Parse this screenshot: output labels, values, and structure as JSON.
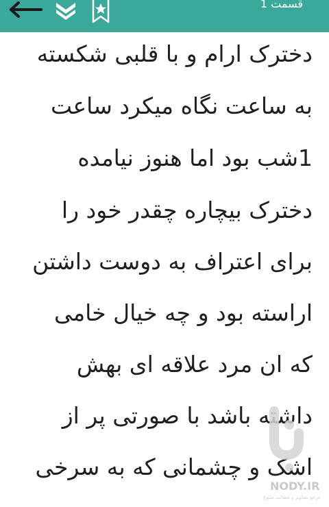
{
  "toolbar": {
    "chapter_title": "قسمت 1",
    "colors": {
      "bar": "#3aa89a",
      "icon": "#ffffff",
      "back_icon": "#1a1a1a"
    },
    "icons": {
      "back": "arrow-left-icon",
      "layers": "layers-chevron-icon",
      "bookmark": "bookmark-star-icon"
    }
  },
  "story": {
    "lines": [
      "دخترک ارام و با قلبی شکسته",
      "به ساعت نگاه میکرد ساعت",
      "1شب بود اما هنوز نیامده",
      "دخترک بیچاره چقدر خود را",
      "برای اعتراف به دوست داشتن",
      "اراسته بود و چه خیال خامی",
      "که ان مرد علاقه ای بهش",
      "داشته باشد با صورتی پر از",
      "اشک و چشمانی که به سرخی"
    ]
  },
  "watermark": {
    "text": "NODY.IR",
    "subtext": "مرجع تصاویر و مطالب متنوع",
    "color": "#c9c9c9"
  }
}
